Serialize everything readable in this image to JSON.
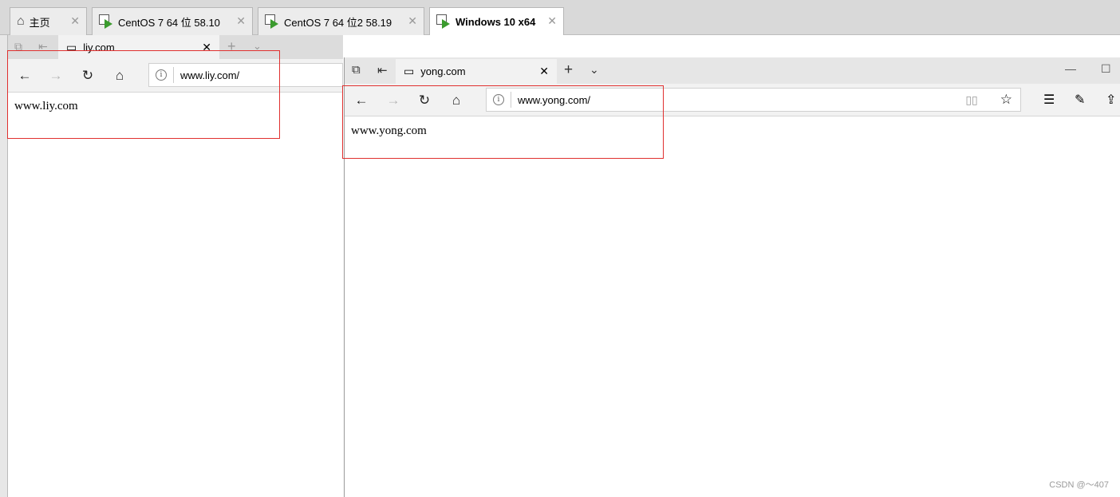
{
  "vmware": {
    "tabs": [
      {
        "label": "主页",
        "icon": "home-icon",
        "active": false
      },
      {
        "label": "CentOS 7 64 位 58.10",
        "icon": "vm-icon",
        "active": false
      },
      {
        "label": "CentOS 7 64 位2 58.19",
        "icon": "vm-icon",
        "active": false
      },
      {
        "label": "Windows 10 x64",
        "icon": "vm-icon",
        "active": true
      }
    ]
  },
  "browser_back": {
    "tab_title": "liy.com",
    "address": "www.liy.com/",
    "page_text": "www.liy.com"
  },
  "browser_front": {
    "tab_title": "yong.com",
    "address": "www.yong.com/",
    "page_text": "www.yong.com"
  },
  "watermark": "CSDN @～407",
  "colors": {
    "highlight_box": "#e0302f",
    "play_green": "#3b9b2e"
  }
}
